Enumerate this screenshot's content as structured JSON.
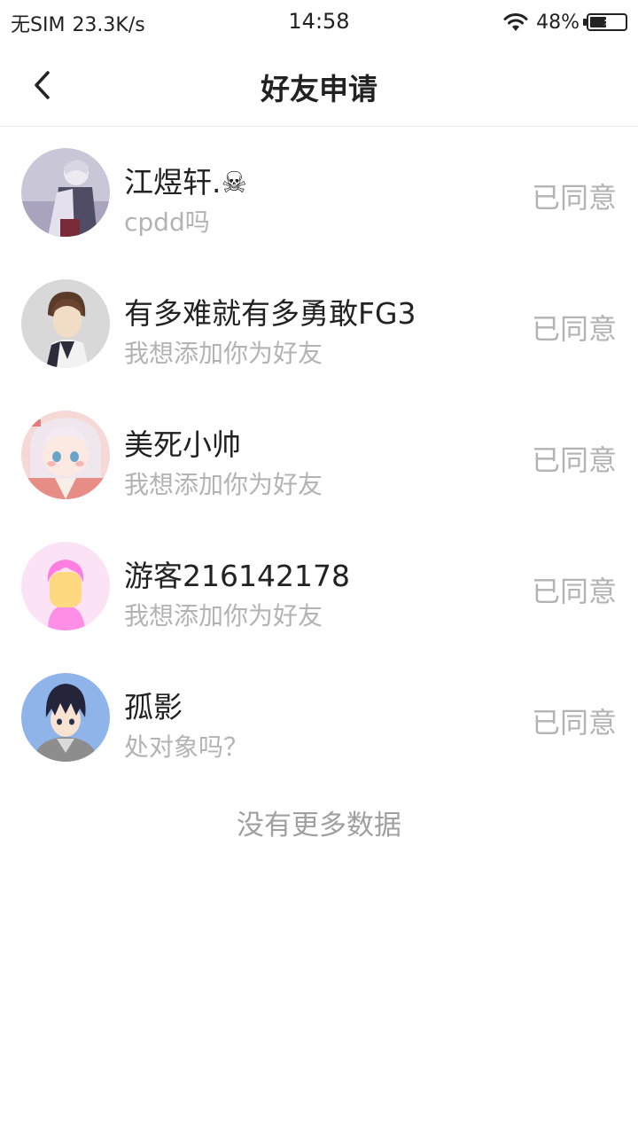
{
  "status_bar": {
    "carrier": "无SIM",
    "speed": "23.3K/s",
    "time": "14:58",
    "battery_percent": "48%",
    "battery_level": 0.48,
    "icons": [
      "wifi-icon",
      "battery-charging-icon"
    ]
  },
  "header": {
    "title": "好友申请",
    "back_icon": "chevron-left-icon"
  },
  "requests": [
    {
      "name": "江煜轩.☠",
      "message": "cpdd吗",
      "status": "已同意",
      "avatar": "avatar-anime-figure"
    },
    {
      "name": "有多难就有多勇敢FG3",
      "message": "我想添加你为好友",
      "status": "已同意",
      "avatar": "avatar-anime-boy"
    },
    {
      "name": "美死小帅",
      "message": "我想添加你为好友",
      "status": "已同意",
      "avatar": "avatar-anime-girl"
    },
    {
      "name": "游客216142178",
      "message": "我想添加你为好友",
      "status": "已同意",
      "avatar": "avatar-default-guest"
    },
    {
      "name": "孤影",
      "message": "处对象吗？",
      "status": "已同意",
      "avatar": "avatar-anime-hoodie-boy"
    }
  ],
  "footer": {
    "no_more_text": "没有更多数据"
  },
  "colors": {
    "primary_text": "#222222",
    "secondary_text": "#b3b3b3",
    "divider": "#e6e6e6",
    "guest_avatar_bg": "#fbe3f5",
    "guest_avatar_head": "#ff7ee0",
    "guest_avatar_face": "#ffd980"
  }
}
